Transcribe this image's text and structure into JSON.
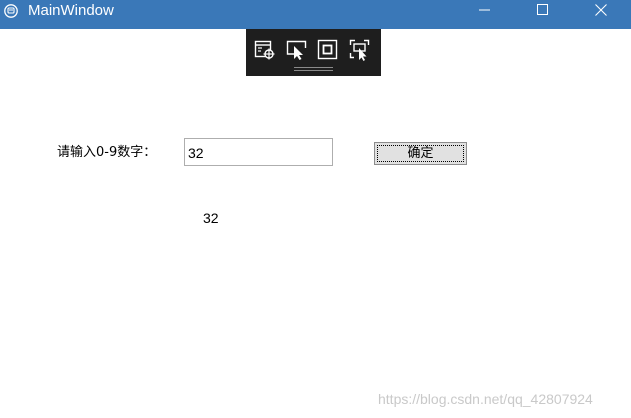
{
  "window": {
    "title": "MainWindow"
  },
  "titlebar_buttons": {
    "minimize_icon": "minimize-icon",
    "maximize_icon": "maximize-icon",
    "close_icon": "close-icon"
  },
  "debug_toolbar": {
    "tools": [
      "live-visual-tree-icon",
      "select-element-icon",
      "display-layout-adorners-icon",
      "track-focused-element-icon"
    ]
  },
  "form": {
    "prompt_label": "请输入0-9数字：",
    "input_value": "32",
    "confirm_label": "确定",
    "result_text": "32"
  },
  "watermark": {
    "text": "https://blog.csdn.net/qq_42807924"
  },
  "colors": {
    "titlebar": "#3a78b8",
    "toolbar": "#1e1e1e",
    "button_face": "#e1e1e1",
    "watermark": "#c9c9c9"
  }
}
